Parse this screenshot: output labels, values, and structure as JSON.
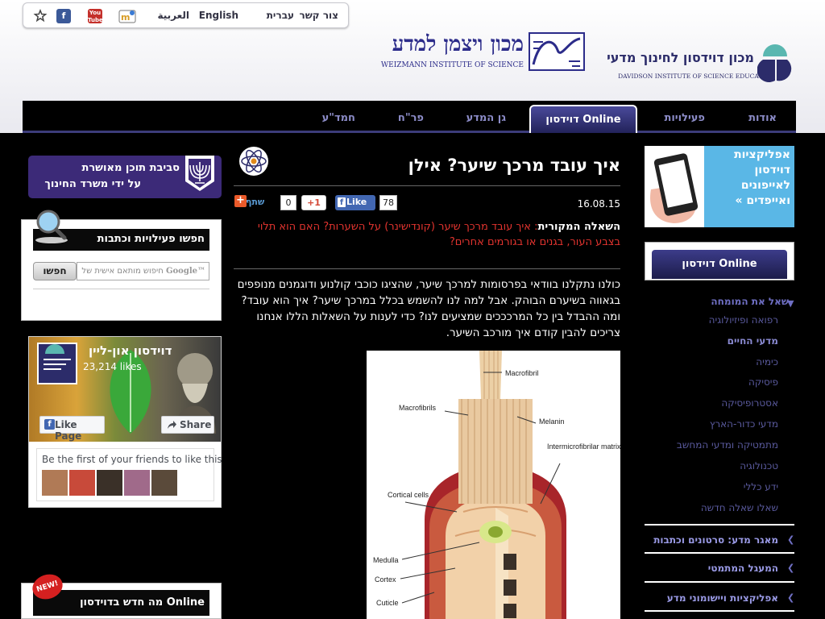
{
  "topbar": {
    "contact": "צור קשר",
    "hebrew": "עברית",
    "english": "English",
    "arabic": "العربية",
    "youtube": "You Tube",
    "facebook": "f"
  },
  "logos": {
    "weizmann_hebrew": "מכון ויצמן למדע",
    "weizmann_english": "WEIZMANN INSTITUTE OF SCIENCE",
    "davidson_hebrew": "מכון דוידסון לחינוך מדעי",
    "davidson_english": "DAVIDSON INSTITUTE OF SCIENCE EDUCATION"
  },
  "nav": {
    "items": [
      "אודות",
      "פעילויות",
      "דוידסון Online",
      "גן המדע",
      "פר\"ח",
      "חמד\"ע"
    ],
    "active": "דוידסון Online"
  },
  "left": {
    "edu_banner_line1": "סביבת תוכן מאושרת",
    "edu_banner_line2": "על ידי משרד החינוך",
    "search_title": "חפשו פעילויות וכתבות",
    "search_button": "חפשו",
    "search_placeholder": "חיפוש מותאם אישית של",
    "search_brand": "Google™",
    "fb_page_name": "דוידסון און-ליין",
    "fb_likes": "23,214 likes",
    "fb_like_page": "Like Page",
    "fb_share": "Share",
    "fb_friends_prompt": "Be the first of your friends to like this",
    "new_badge": "NEW!",
    "new_title": "מה חדש בדוידסון Online"
  },
  "article": {
    "title": "איך עובד מרכך שיער? אילן",
    "date": "16.08.15",
    "fb_count": "78",
    "fb_like": "Like",
    "gplus": "+1",
    "gplus_count": "0",
    "share": "שתף",
    "orig_label": "השאלה המקורית",
    "orig_text": ": איך עובד מרכך שיער (קונדישינר) על השערות? האם הוא תלוי בצבע העור, בגנים או בגורמים אחרים?",
    "body": "כולנו נתקלנו בוודאי בפרסומות למרכך שיער, שהציגו כוכבי קולנוע ודוגמנים מנופפים בגאווה בשיערם הבוהק. אבל למה לנו להשמש בכלל במרכך שיער? איך הוא עובד? ומה ההבדל בין כל המרכככים שמציעים לנו? כדי לענות על השאלות הללו אנחנו צריכים להבין קודם איך מורכב השיער."
  },
  "diagram": {
    "labels": [
      "Macrofibril",
      "Macrofibrils",
      "Melanin",
      "Intermicrofibrilar matrix",
      "Cortical cells",
      "Medulla",
      "Cortex",
      "Cuticle"
    ]
  },
  "right": {
    "app_banner": "אפליקציות דוידסון לאייפונים ואייפדים »",
    "tab": "דוידסון Online",
    "menu_heading": "שאל את המומחה",
    "menu_items": [
      "רפואה ופיזיולוגיה",
      "מדעי החיים",
      "כימיה",
      "פיסיקה",
      "אסטרופיסיקה",
      "מדעי כדור-הארץ",
      "מתמטיקה ומדעי המחשב",
      "טכנולוגיה",
      "ידע כללי",
      "שאלו שאלה חדשה"
    ],
    "selected_item": "מדעי החיים",
    "categories": [
      "מאגר מדע: סרטונים וכתבות",
      "המעגל המתמטי",
      "אפליקציות ויישומוני מדע"
    ]
  },
  "colors": {
    "accent_purple": "#3c2a78",
    "nav_blue": "#2c2c6a",
    "link_red": "#e3342f",
    "menu_text": "#5a5a9e",
    "page_background": "#000000"
  }
}
